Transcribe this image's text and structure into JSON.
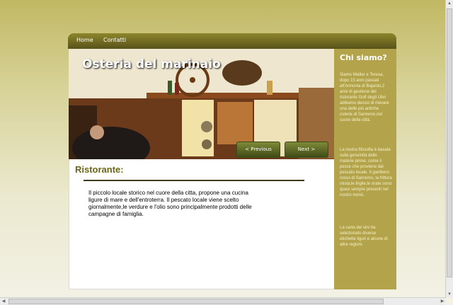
{
  "nav": {
    "items": [
      {
        "label": "Home"
      },
      {
        "label": "Contatti"
      }
    ]
  },
  "hero": {
    "title": "Osteria del marinaio",
    "prev_label": "< Previous",
    "next_label": "Next >"
  },
  "content": {
    "title": "Ristorante:",
    "body": "Il piccolo locale storico nel cuore della citta, propone una cucina ligure di mare e dell'entroterra. Il pescato locale viene scelto giornalmente,le verdure e l'olio sono principalmente prodotti delle campagne di famiglia."
  },
  "sidebar": {
    "title": "Chi siamo?",
    "paragraphs": [
      "Siamo Walter e Teresa, dopo 15 anni passati all'Armonia di Bajardo,2 anni di gestione del ristorante Golf degli Ulivi abbiamo deciso di rilevare una delle più antiche osterie di Sanremo,nel cuore della città.",
      "La nostra filosofia è basata sulla genuinità delle materie prime, come il pesce che proviene dal pescato locale. Il gambero rosso di Sanremo, la frittura mista,le triglie,le orate sono quasi sempre presenti nel nostro menù.",
      "La carta dei vini ha selezionato diverse etichette liguri e alcune di altre regioni."
    ]
  },
  "colors": {
    "accent": "#6b6518",
    "sidebar_bg": "#b3a44b",
    "navbar": "#575219"
  },
  "icons": {
    "scroll_up": "up-arrow-icon",
    "scroll_down": "down-arrow-icon",
    "scroll_left": "left-arrow-icon",
    "scroll_right": "right-arrow-icon"
  }
}
